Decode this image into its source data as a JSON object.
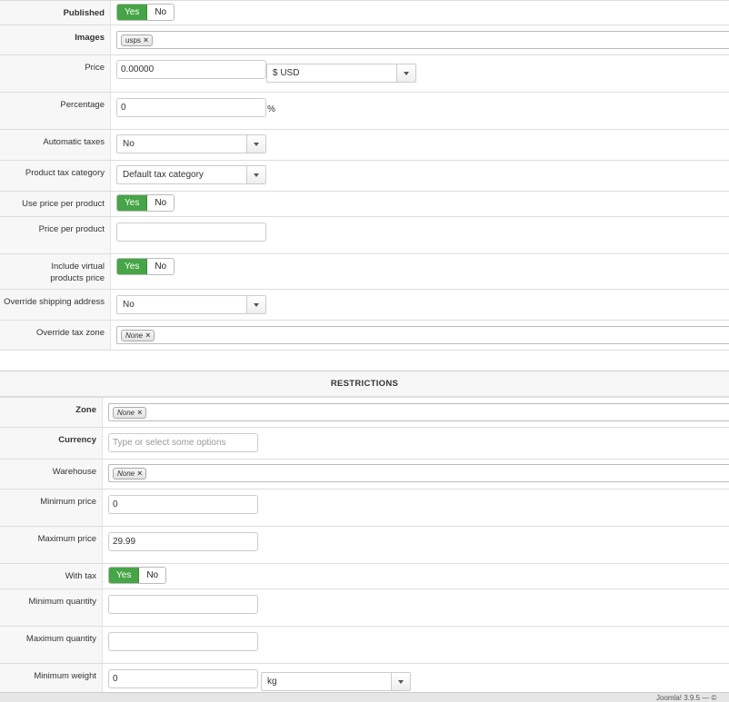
{
  "general": {
    "published": {
      "label": "Published",
      "yes": "Yes",
      "no": "No"
    },
    "images": {
      "label": "Images",
      "tag": "usps",
      "remove": "×"
    },
    "price": {
      "label": "Price",
      "value": "0.00000",
      "currency": "$ USD"
    },
    "percentage": {
      "label": "Percentage",
      "value": "0",
      "suffix": "%"
    },
    "automatic_taxes": {
      "label": "Automatic taxes",
      "value": "No"
    },
    "product_tax_category": {
      "label": "Product tax category",
      "value": "Default tax category"
    },
    "use_price_per_product": {
      "label": "Use price per product",
      "yes": "Yes",
      "no": "No"
    },
    "price_per_product": {
      "label": "Price per product",
      "value": ""
    },
    "include_virtual": {
      "label_line1": "Include virtual",
      "label_line2": "products price",
      "yes": "Yes",
      "no": "No"
    },
    "override_shipping_address": {
      "label": "Override shipping address",
      "value": "No"
    },
    "override_tax_zone": {
      "label": "Override tax zone",
      "tag": "None",
      "remove": "×"
    }
  },
  "restrictions": {
    "title": "RESTRICTIONS",
    "zone": {
      "label": "Zone",
      "tag": "None",
      "remove": "×"
    },
    "currency": {
      "label": "Currency",
      "placeholder": "Type or select some options"
    },
    "warehouse": {
      "label": "Warehouse",
      "tag": "None",
      "remove": "×"
    },
    "minimum_price": {
      "label": "Minimum price",
      "value": "0"
    },
    "maximum_price": {
      "label": "Maximum price",
      "value": "29.99"
    },
    "with_tax": {
      "label": "With tax",
      "yes": "Yes",
      "no": "No"
    },
    "minimum_quantity": {
      "label": "Minimum quantity",
      "value": ""
    },
    "maximum_quantity": {
      "label": "Maximum quantity",
      "value": ""
    },
    "minimum_weight": {
      "label": "Minimum weight",
      "value": "0",
      "unit": "kg"
    }
  },
  "footer": {
    "text": "Joomla! 3.9.5 — ©"
  },
  "colors": {
    "toggle_on": "#46a546"
  }
}
